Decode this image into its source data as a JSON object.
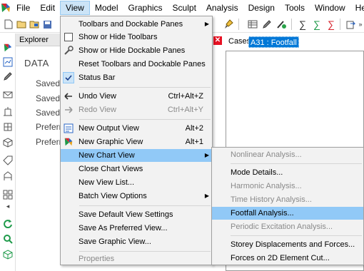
{
  "menubar": {
    "items": [
      "File",
      "Edit",
      "View",
      "Model",
      "Graphics",
      "Sculpt",
      "Analysis",
      "Design",
      "Tools",
      "Window",
      "Help"
    ],
    "active": "View"
  },
  "explorer": {
    "title": "Explorer",
    "data_label": "DATA",
    "items": [
      "Saved",
      "Saved",
      "Saved",
      "Preferr",
      "Preferr"
    ]
  },
  "cases": {
    "label": "Cases",
    "value": "A31 : Footfall"
  },
  "view_menu": {
    "items": [
      {
        "label": "Toolbars and Dockable Panes",
        "submenu": true
      },
      {
        "label": "Show or Hide Toolbars",
        "icon": "toolbar-box-icon"
      },
      {
        "label": "Show or Hide Dockable Panes",
        "icon": "wrench-icon"
      },
      {
        "label": "Reset Toolbars and Dockable Panes"
      },
      {
        "label": "Status Bar",
        "checked": true
      },
      {
        "label": "Undo View",
        "shortcut": "Ctrl+Alt+Z",
        "icon": "back-arrow-icon"
      },
      {
        "label": "Redo View",
        "shortcut": "Ctrl+Alt+Y",
        "disabled": true,
        "icon": "forward-arrow-icon"
      },
      {
        "label": "New Output View",
        "shortcut": "Alt+2",
        "icon": "output-view-icon"
      },
      {
        "label": "New Graphic View",
        "shortcut": "Alt+1",
        "icon": "graphic-view-icon"
      },
      {
        "label": "New Chart View",
        "submenu": true,
        "highlighted": true
      },
      {
        "label": "Close Chart Views"
      },
      {
        "label": "New View List..."
      },
      {
        "label": "Batch View Options",
        "submenu": true
      },
      {
        "label": "Save Default View Settings"
      },
      {
        "label": "Save As Preferred View..."
      },
      {
        "label": "Save Graphic View..."
      },
      {
        "label": "Properties",
        "disabled": true
      }
    ]
  },
  "chart_submenu": {
    "items": [
      {
        "label": "Nonlinear Analysis...",
        "disabled": true
      },
      {
        "label": "Mode Details..."
      },
      {
        "label": "Harmonic Analysis...",
        "disabled": true
      },
      {
        "label": "Time History Analysis...",
        "disabled": true
      },
      {
        "label": "Footfall Analysis...",
        "highlighted": true
      },
      {
        "label": "Periodic Excitation Analysis...",
        "disabled": true
      },
      {
        "label": "Storey Displacements and Forces..."
      },
      {
        "label": "Forces on 2D Element Cut..."
      }
    ]
  }
}
